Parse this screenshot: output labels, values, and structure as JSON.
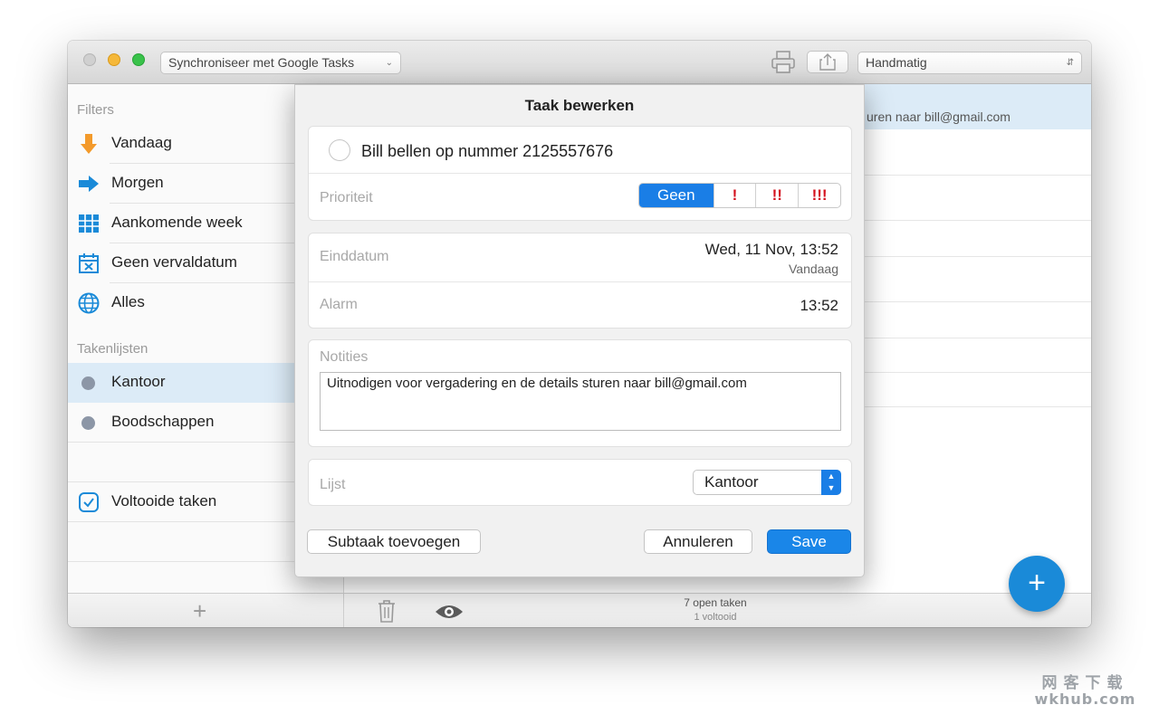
{
  "toolbar": {
    "sync_label": "Synchroniseer met Google Tasks",
    "sort_label": "Handmatig"
  },
  "sidebar": {
    "filters_header": "Filters",
    "filters": [
      {
        "label": "Vandaag",
        "icon": "arrow-down-icon"
      },
      {
        "label": "Morgen",
        "icon": "arrow-right-icon"
      },
      {
        "label": "Aankomende week",
        "icon": "calendar-week-icon"
      },
      {
        "label": "Geen vervaldatum",
        "icon": "calendar-x-icon"
      },
      {
        "label": "Alles",
        "icon": "globe-icon"
      }
    ],
    "lists_header": "Takenlijsten",
    "lists": [
      {
        "label": "Kantoor",
        "selected": true
      },
      {
        "label": "Boodschappen",
        "selected": false
      }
    ],
    "completed_label": "Voltooide taken"
  },
  "list_peek": "uren naar bill@gmail.com",
  "status": {
    "open": "7 open taken",
    "done": "1 voltooid"
  },
  "dialog": {
    "title": "Taak bewerken",
    "task_title": "Bill bellen op nummer 2125557676",
    "priority_label": "Prioriteit",
    "priority_options": [
      "Geen",
      "!",
      "!!",
      "!!!"
    ],
    "priority_selected": "Geen",
    "due_label": "Einddatum",
    "due_value": "Wed, 11 Nov, 13:52",
    "due_sub": "Vandaag",
    "alarm_label": "Alarm",
    "alarm_value": "13:52",
    "notes_label": "Notities",
    "notes_value": "Uitnodigen voor vergadering en de details sturen naar bill@gmail.com",
    "list_label": "Lijst",
    "list_value": "Kantoor",
    "add_subtask": "Subtaak toevoegen",
    "cancel": "Annuleren",
    "save": "Save"
  },
  "watermark": {
    "line1": "网客下载",
    "line2": "wkhub.com"
  },
  "colors": {
    "accent": "#1a7ee6",
    "selection": "#dcebf7",
    "priority": "#d4121e"
  }
}
